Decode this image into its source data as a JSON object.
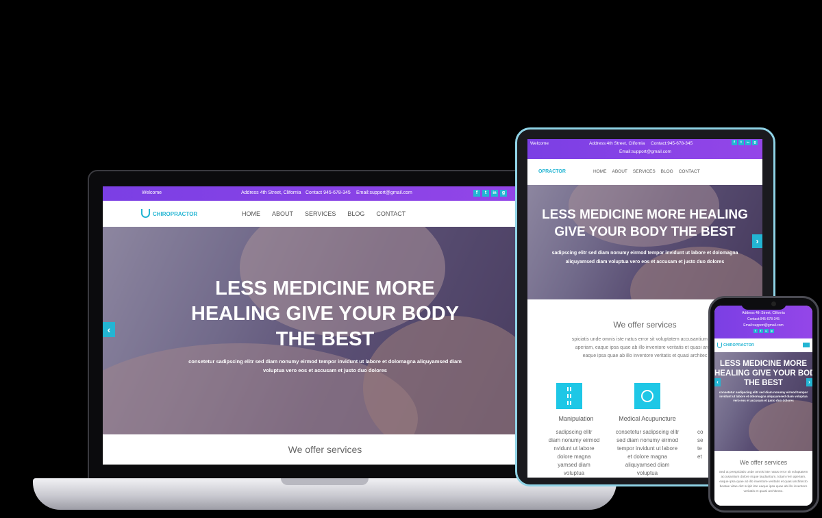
{
  "brand": {
    "name": "CHIROPRACTOR",
    "primary": "#8e44e6",
    "accent": "#23b5d3"
  },
  "topbar": {
    "welcome": "Welcome",
    "address": "Address 4th Street, Clifornia",
    "contact": "Contact 945-678-345",
    "email": "Email:support@gmail.com",
    "social": [
      "f",
      "t",
      "in",
      "g"
    ]
  },
  "tablet_topbar": {
    "welcome": "Welcome",
    "address": "Address:4th Street, Clifornia",
    "contact": "Contact:945-678-345",
    "email": "Email:support@gmail.com"
  },
  "phone_topbar": {
    "address": "Address 4th Street, Clifornia",
    "contact": "Contact:945-678-345",
    "email": "Email:support@gmail.com"
  },
  "nav": [
    "HOME",
    "ABOUT",
    "SERVICES",
    "BLOG",
    "CONTACT"
  ],
  "tablet_logo": "OPRACTOR",
  "hero": {
    "title": "LESS MEDICINE MORE HEALING GIVE YOUR BODY THE BEST",
    "laptop_lines": [
      "LESS MEDICINE MORE",
      "HEALING GIVE YOUR BODY",
      "THE BEST"
    ],
    "tablet_lines": [
      "LESS MEDICINE MORE HEALING",
      "GIVE YOUR BODY THE BEST"
    ],
    "phone_lines": [
      "LESS MEDICINE MORE",
      "HEALING GIVE YOUR BODY",
      "THE BEST"
    ],
    "subtitle_lines": [
      "consetetur sadipscing elitr sed diam nonumy eirmod tempor invidunt ut labore et dolomagna aliquyamsed diam",
      "voluptua vero eos et accusam et justo duo dolores"
    ],
    "tablet_sub_lines": [
      "sadipscing elitr sed diam nonumy eirmod tempor invidunt ut labore et dolomagna",
      "aliquyamsed diam voluptua vero eos et accusam et justo duo dolores"
    ],
    "phone_sub": "consetetur sadipscing elitr sed diam nonumy eirmod tempor invidunt ut labore et dolomagna aliquyamsed diam voluptua vero eos et accusam et justo duo dolores",
    "prev": "‹",
    "next": "›"
  },
  "services": {
    "title": "We offer services",
    "tablet_intro": [
      "spiciatis unde omnis iste natus error sit voluptatem accusantium dolo",
      "aperiam, eaque ipsa quae ab illo inventore veritatis et quasi archit",
      "eaque ipsa quae ab illo inventore veritatis et quasi architec"
    ],
    "phone_intro": "Sed ut perspiciatis unde omnis iste natus error sit voluptatem accusantium dolore mque laudantium, totam rem aperiam, eaque ipsa quae ab illo inventore veritatis et quasi architecto beatae vitae dict scipit iste eaque ipsa quae ab illo inventore veritatis et quasi architecto.",
    "cards": [
      {
        "title": "Manipulation",
        "lines": [
          "sadipscing elitr",
          "diam nonumy eirmod",
          "nvidunt ut labore",
          "dolore magna",
          "yamsed diam",
          "voluptua"
        ]
      },
      {
        "title": "Medical Acupuncture",
        "lines": [
          "consetetur sadipscing elitr",
          "sed diam nonumy eirmod",
          "tempor invidunt ut labore",
          "et dolore magna",
          "aliquyamsed diam",
          "voluptua"
        ]
      },
      {
        "title": "",
        "lines": [
          "co",
          "se",
          "te",
          "et"
        ]
      }
    ]
  },
  "calendar_icon": "calendar-icon"
}
